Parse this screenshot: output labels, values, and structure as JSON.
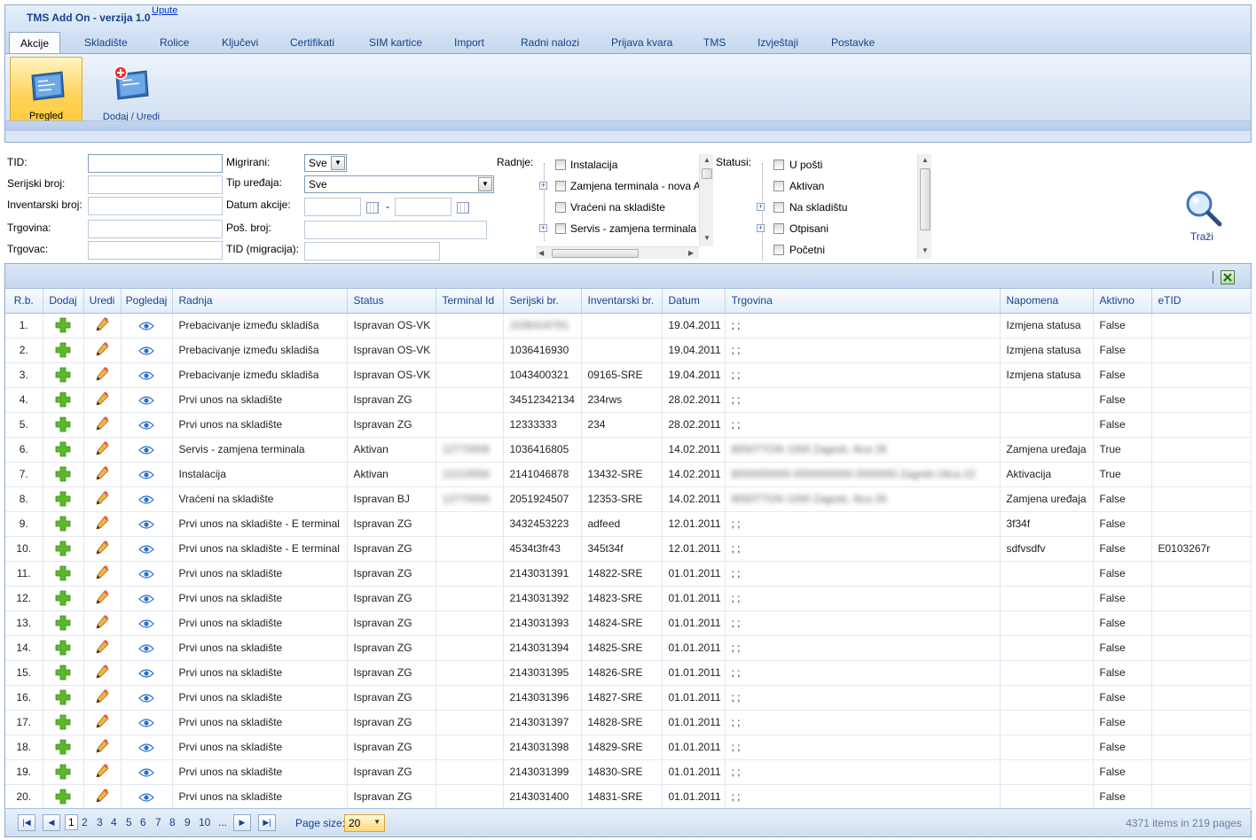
{
  "app": {
    "title": "TMS Add On - verzija 1.0",
    "help_link": "Upute"
  },
  "tabs": [
    "Akcije",
    "Skladište",
    "Rolice",
    "Ključevi",
    "Certifikati",
    "SIM kartice",
    "Import",
    "Radni nalozi",
    "Prijava kvara",
    "TMS",
    "Izvještaji",
    "Postavke"
  ],
  "ribbon": {
    "pregled_label": "Pregled",
    "dodaj_uredi_label": "Dodaj / Uredi"
  },
  "filters": {
    "tid_label": "TID:",
    "tid_value": "",
    "serijski_label": "Serijski broj:",
    "inventarski_label": "Inventarski broj:",
    "trgovina_label": "Trgovina:",
    "trgovac_label": "Trgovac:",
    "migrirani_label": "Migrirani:",
    "migrirani_value": "Sve",
    "tip_uredaja_label": "Tip uređaja:",
    "tip_uredaja_value": "Sve",
    "datum_akcije_label": "Datum akcije:",
    "date_separator": "-",
    "pos_broj_label": "Poš. broj:",
    "tid_migracija_label": "TID (migracija):",
    "radnje_label": "Radnje:",
    "radnje_items": [
      "Instalacija",
      "Zamjena terminala - nova A",
      "Vraćeni na skladište",
      "Servis - zamjena terminala"
    ],
    "statusi_label": "Statusi:",
    "statusi_items": [
      "U pošti",
      "Aktivan",
      "Na skladištu",
      "Otpisani",
      "Početni"
    ],
    "search_label": "Traži"
  },
  "grid": {
    "columns": [
      "R.b.",
      "Dodaj",
      "Uredi",
      "Pogledaj",
      "Radnja",
      "Status",
      "Terminal Id",
      "Serijski br.",
      "Inventarski br.",
      "Datum",
      "Trgovina",
      "Napomena",
      "Aktivno",
      "eTID"
    ],
    "rows": [
      {
        "rb": "1.",
        "radnja": "Prebacivanje između skladiša",
        "status": "Ispravan OS-VK",
        "terminal_id": "",
        "serijski": "1036416781",
        "serijski_blur": true,
        "inventarski": "",
        "datum": "19.04.2011",
        "trgovina": "; ;",
        "trgovina_blur": false,
        "napomena": "Izmjena statusa",
        "aktivno": "False",
        "etid": ""
      },
      {
        "rb": "2.",
        "radnja": "Prebacivanje između skladiša",
        "status": "Ispravan OS-VK",
        "terminal_id": "",
        "serijski": "1036416930",
        "serijski_blur": false,
        "inventarski": "",
        "datum": "19.04.2011",
        "trgovina": "; ;",
        "trgovina_blur": false,
        "napomena": "Izmjena statusa",
        "aktivno": "False",
        "etid": ""
      },
      {
        "rb": "3.",
        "radnja": "Prebacivanje između skladiša",
        "status": "Ispravan OS-VK",
        "terminal_id": "",
        "serijski": "1043400321",
        "serijski_blur": false,
        "inventarski": "09165-SRE",
        "datum": "19.04.2011",
        "trgovina": "; ;",
        "trgovina_blur": false,
        "napomena": "Izmjena statusa",
        "aktivno": "False",
        "etid": ""
      },
      {
        "rb": "4.",
        "radnja": "Prvi unos na skladište",
        "status": "Ispravan ZG",
        "terminal_id": "",
        "serijski": "34512342134",
        "serijski_blur": false,
        "inventarski": "234rws",
        "datum": "28.02.2011",
        "trgovina": "; ;",
        "trgovina_blur": false,
        "napomena": "",
        "aktivno": "False",
        "etid": ""
      },
      {
        "rb": "5.",
        "radnja": "Prvi unos na skladište",
        "status": "Ispravan ZG",
        "terminal_id": "",
        "serijski": "12333333",
        "serijski_blur": false,
        "inventarski": "234",
        "datum": "28.02.2011",
        "trgovina": "; ;",
        "trgovina_blur": false,
        "napomena": "",
        "aktivno": "False",
        "etid": ""
      },
      {
        "rb": "6.",
        "radnja": "Servis - zamjena terminala",
        "status": "Aktivan",
        "terminal_id": "12770006",
        "serijski": "1036416805",
        "serijski_blur": false,
        "inventarski": "",
        "datum": "14.02.2011",
        "trgovina": "8050TTON 1000 Zagreb, Ilica 26",
        "trgovina_blur": true,
        "napomena": "Zamjena uređaja",
        "aktivno": "True",
        "etid": ""
      },
      {
        "rb": "7.",
        "radnja": "Instalacija",
        "status": "Aktivan",
        "terminal_id": "12210056",
        "serijski": "2141046878",
        "serijski_blur": false,
        "inventarski": "13432-SRE",
        "datum": "14.02.2011",
        "trgovina": "8000000000 0000000000 0000000 Zagreb Ulica 22",
        "trgovina_blur": true,
        "napomena": "Aktivacija",
        "aktivno": "True",
        "etid": ""
      },
      {
        "rb": "8.",
        "radnja": "Vraćeni na skladište",
        "status": "Ispravan BJ",
        "terminal_id": "12770006",
        "serijski": "2051924507",
        "serijski_blur": false,
        "inventarski": "12353-SRE",
        "datum": "14.02.2011",
        "trgovina": "8050TTON 1000 Zagreb, Ilica 26",
        "trgovina_blur": true,
        "napomena": "Zamjena uređaja",
        "aktivno": "False",
        "etid": ""
      },
      {
        "rb": "9.",
        "radnja": "Prvi unos na skladište - E terminal",
        "status": "Ispravan ZG",
        "terminal_id": "",
        "serijski": "3432453223",
        "serijski_blur": false,
        "inventarski": "adfeed",
        "datum": "12.01.2011",
        "trgovina": "; ;",
        "trgovina_blur": false,
        "napomena": "3f34f",
        "aktivno": "False",
        "etid": ""
      },
      {
        "rb": "10.",
        "radnja": "Prvi unos na skladište - E terminal",
        "status": "Ispravan ZG",
        "terminal_id": "",
        "serijski": "4534t3fr43",
        "serijski_blur": false,
        "inventarski": "345t34f",
        "datum": "12.01.2011",
        "trgovina": "; ;",
        "trgovina_blur": false,
        "napomena": "sdfvsdfv",
        "aktivno": "False",
        "etid": "E0103267r"
      },
      {
        "rb": "11.",
        "radnja": "Prvi unos na skladište",
        "status": "Ispravan ZG",
        "terminal_id": "",
        "serijski": "2143031391",
        "serijski_blur": false,
        "inventarski": "14822-SRE",
        "datum": "01.01.2011",
        "trgovina": "; ;",
        "trgovina_blur": false,
        "napomena": "",
        "aktivno": "False",
        "etid": ""
      },
      {
        "rb": "12.",
        "radnja": "Prvi unos na skladište",
        "status": "Ispravan ZG",
        "terminal_id": "",
        "serijski": "2143031392",
        "serijski_blur": false,
        "inventarski": "14823-SRE",
        "datum": "01.01.2011",
        "trgovina": "; ;",
        "trgovina_blur": false,
        "napomena": "",
        "aktivno": "False",
        "etid": ""
      },
      {
        "rb": "13.",
        "radnja": "Prvi unos na skladište",
        "status": "Ispravan ZG",
        "terminal_id": "",
        "serijski": "2143031393",
        "serijski_blur": false,
        "inventarski": "14824-SRE",
        "datum": "01.01.2011",
        "trgovina": "; ;",
        "trgovina_blur": false,
        "napomena": "",
        "aktivno": "False",
        "etid": ""
      },
      {
        "rb": "14.",
        "radnja": "Prvi unos na skladište",
        "status": "Ispravan ZG",
        "terminal_id": "",
        "serijski": "2143031394",
        "serijski_blur": false,
        "inventarski": "14825-SRE",
        "datum": "01.01.2011",
        "trgovina": "; ;",
        "trgovina_blur": false,
        "napomena": "",
        "aktivno": "False",
        "etid": ""
      },
      {
        "rb": "15.",
        "radnja": "Prvi unos na skladište",
        "status": "Ispravan ZG",
        "terminal_id": "",
        "serijski": "2143031395",
        "serijski_blur": false,
        "inventarski": "14826-SRE",
        "datum": "01.01.2011",
        "trgovina": "; ;",
        "trgovina_blur": false,
        "napomena": "",
        "aktivno": "False",
        "etid": ""
      },
      {
        "rb": "16.",
        "radnja": "Prvi unos na skladište",
        "status": "Ispravan ZG",
        "terminal_id": "",
        "serijski": "2143031396",
        "serijski_blur": false,
        "inventarski": "14827-SRE",
        "datum": "01.01.2011",
        "trgovina": "; ;",
        "trgovina_blur": false,
        "napomena": "",
        "aktivno": "False",
        "etid": ""
      },
      {
        "rb": "17.",
        "radnja": "Prvi unos na skladište",
        "status": "Ispravan ZG",
        "terminal_id": "",
        "serijski": "2143031397",
        "serijski_blur": false,
        "inventarski": "14828-SRE",
        "datum": "01.01.2011",
        "trgovina": "; ;",
        "trgovina_blur": false,
        "napomena": "",
        "aktivno": "False",
        "etid": ""
      },
      {
        "rb": "18.",
        "radnja": "Prvi unos na skladište",
        "status": "Ispravan ZG",
        "terminal_id": "",
        "serijski": "2143031398",
        "serijski_blur": false,
        "inventarski": "14829-SRE",
        "datum": "01.01.2011",
        "trgovina": "; ;",
        "trgovina_blur": false,
        "napomena": "",
        "aktivno": "False",
        "etid": ""
      },
      {
        "rb": "19.",
        "radnja": "Prvi unos na skladište",
        "status": "Ispravan ZG",
        "terminal_id": "",
        "serijski": "2143031399",
        "serijski_blur": false,
        "inventarski": "14830-SRE",
        "datum": "01.01.2011",
        "trgovina": "; ;",
        "trgovina_blur": false,
        "napomena": "",
        "aktivno": "False",
        "etid": ""
      },
      {
        "rb": "20.",
        "radnja": "Prvi unos na skladište",
        "status": "Ispravan ZG",
        "terminal_id": "",
        "serijski": "2143031400",
        "serijski_blur": false,
        "inventarski": "14831-SRE",
        "datum": "01.01.2011",
        "trgovina": "; ;",
        "trgovina_blur": false,
        "napomena": "",
        "aktivno": "False",
        "etid": ""
      }
    ]
  },
  "pager": {
    "pages": [
      "1",
      "2",
      "3",
      "4",
      "5",
      "6",
      "7",
      "8",
      "9",
      "10",
      "..."
    ],
    "current_page": "1",
    "page_size_label": "Page size:",
    "page_size_value": "20",
    "info": "4371 items in 219 pages"
  },
  "colors": {
    "accent": "#15428b",
    "ribbon_bg": "#dae7f6",
    "selected_button": "#ffd35a",
    "add_icon": "#5cb82a",
    "edit_icon": "#e8a020",
    "view_icon": "#2a6fc9"
  }
}
